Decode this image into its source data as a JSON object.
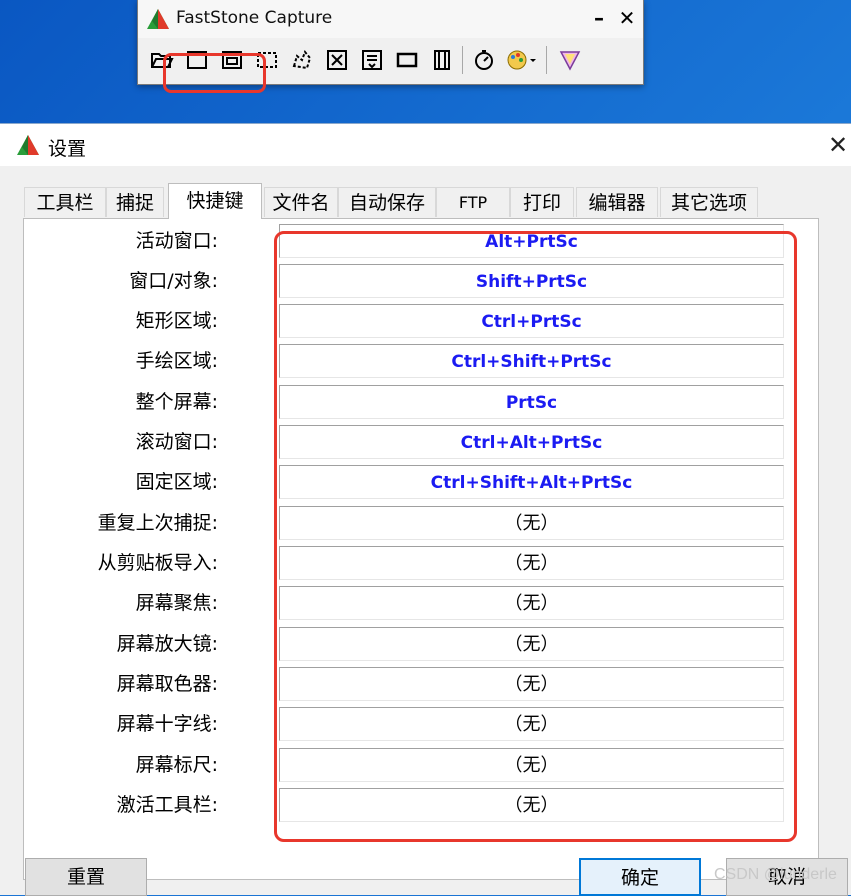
{
  "capture_window": {
    "title": "FastStone Capture",
    "minimize_glyph": "–",
    "close_glyph": "✕",
    "tools": [
      {
        "name": "open-folder-icon"
      },
      {
        "name": "capture-active-window-icon"
      },
      {
        "name": "capture-window-object-icon"
      },
      {
        "name": "capture-rectangle-icon"
      },
      {
        "name": "capture-freehand-icon"
      },
      {
        "name": "capture-fullscreen-icon"
      },
      {
        "name": "capture-scrolling-icon"
      },
      {
        "name": "capture-fixed-region-icon"
      },
      {
        "name": "screen-recorder-icon"
      },
      {
        "name": "delay-timer-icon"
      },
      {
        "name": "output-destination-icon"
      },
      {
        "name": "settings-menu-icon"
      }
    ]
  },
  "dialog": {
    "title": "设置",
    "close_glyph": "✕",
    "tabs": [
      "工具栏",
      "捕捉",
      "快捷键",
      "文件名",
      "自动保存",
      "FTP",
      "打印",
      "编辑器",
      "其它选项"
    ],
    "active_tab": "快捷键",
    "hotkeys": [
      {
        "label": "活动窗口:",
        "value": "Alt+PrtSc",
        "set": true
      },
      {
        "label": "窗口/对象:",
        "value": "Shift+PrtSc",
        "set": true
      },
      {
        "label": "矩形区域:",
        "value": "Ctrl+PrtSc",
        "set": true
      },
      {
        "label": "手绘区域:",
        "value": "Ctrl+Shift+PrtSc",
        "set": true
      },
      {
        "label": "整个屏幕:",
        "value": "PrtSc",
        "set": true
      },
      {
        "label": "滚动窗口:",
        "value": "Ctrl+Alt+PrtSc",
        "set": true
      },
      {
        "label": "固定区域:",
        "value": "Ctrl+Shift+Alt+PrtSc",
        "set": true
      },
      {
        "label": "重复上次捕捉:",
        "value": "（无）",
        "set": false
      },
      {
        "label": "从剪贴板导入:",
        "value": "（无）",
        "set": false
      },
      {
        "label": "屏幕聚焦:",
        "value": "（无）",
        "set": false
      },
      {
        "label": "屏幕放大镜:",
        "value": "（无）",
        "set": false
      },
      {
        "label": "屏幕取色器:",
        "value": "（无）",
        "set": false
      },
      {
        "label": "屏幕十字线:",
        "value": "（无）",
        "set": false
      },
      {
        "label": "屏幕标尺:",
        "value": "（无）",
        "set": false
      },
      {
        "label": "激活工具栏:",
        "value": "（无）",
        "set": false
      }
    ],
    "buttons": {
      "reset": "重置",
      "ok": "确定",
      "cancel": "取消"
    },
    "highlight_color": "#e8372c",
    "hotkey_color": "#1b1bf2"
  },
  "watermark": "CSDN @lunderle"
}
